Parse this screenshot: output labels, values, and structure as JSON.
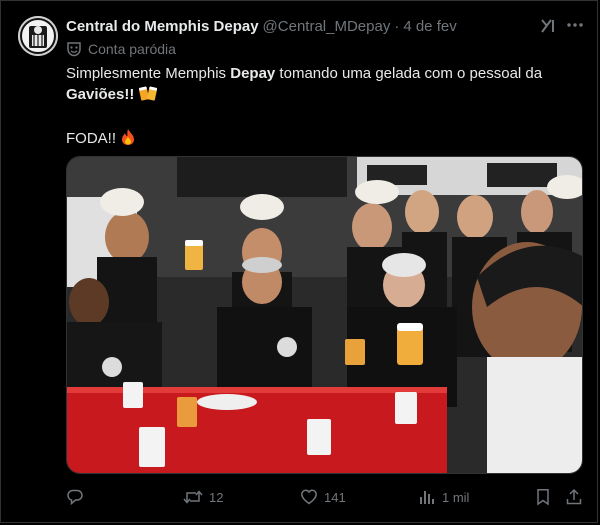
{
  "post": {
    "author_name": "Central do Memphis Depay",
    "handle": "@Central_MDepay",
    "separator": "·",
    "date": "4 de fev",
    "parody_label": "Conta paródia",
    "text_part1": "Simplesmente Memphis ",
    "text_bold1": "Depay",
    "text_part2": " tomando uma gelada com o pessoal da ",
    "text_bold2": "Gaviões!!",
    "text_line2": "FODA!!",
    "media_icon": "photo-group-celebrating"
  },
  "actions": {
    "reply_count": "",
    "retweet_count": "12",
    "like_count": "141",
    "views_count": "1 mil"
  },
  "icons": {
    "reply": "reply-icon",
    "retweet": "retweet-icon",
    "like": "heart-icon",
    "views": "views-icon",
    "bookmark": "bookmark-icon",
    "share": "share-icon",
    "grok": "grok-icon",
    "more": "more-icon",
    "parody": "theater-mask-icon",
    "beer": "beer-mugs-emoji",
    "fire": "fire-emoji"
  },
  "colors": {
    "background": "#000000",
    "text": "#e7e9ea",
    "muted": "#71767b",
    "border": "#2f3336"
  }
}
